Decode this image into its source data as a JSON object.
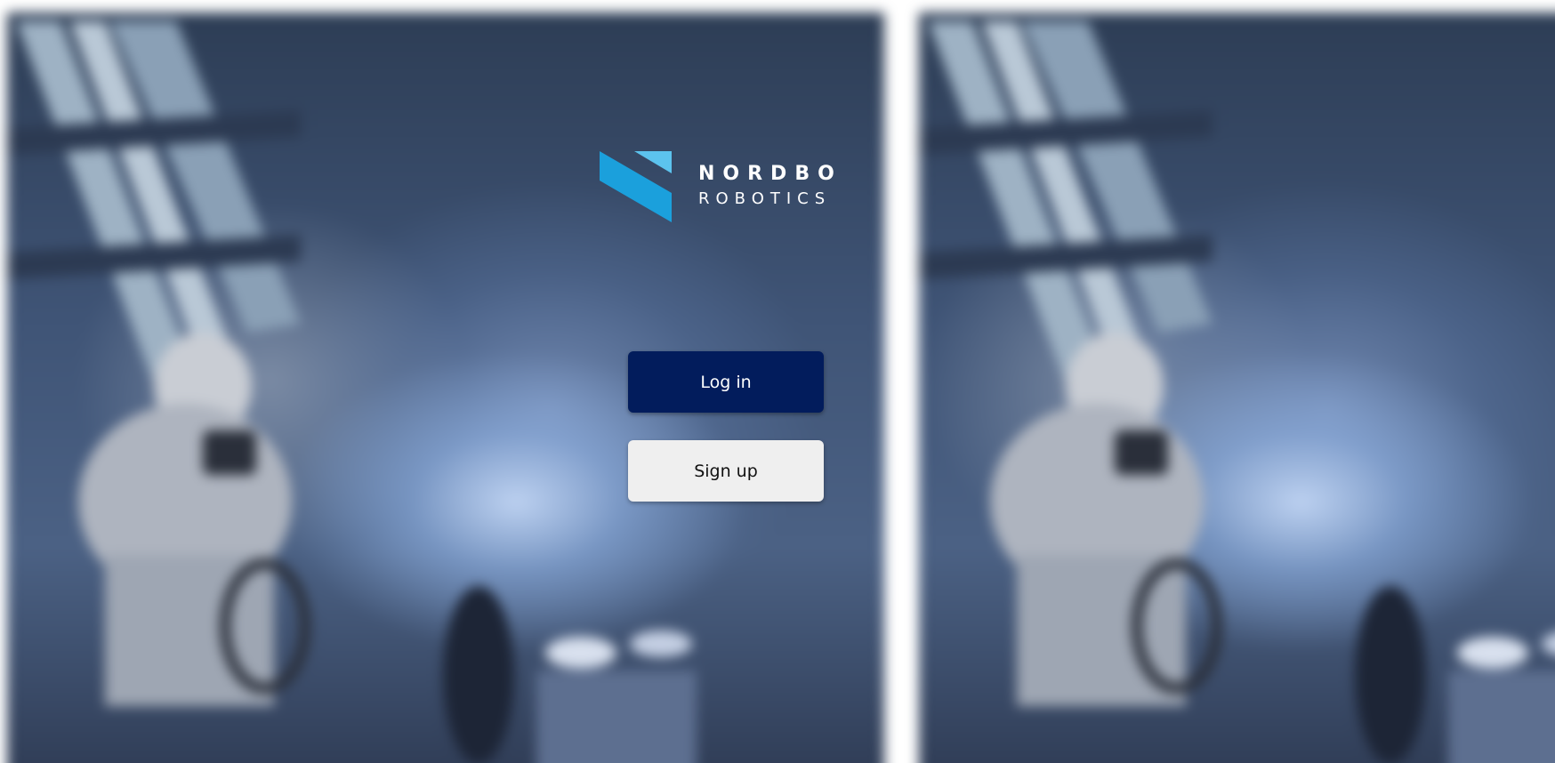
{
  "brand": {
    "name_line1": "NORDBO",
    "name_line2": "ROBOTICS",
    "logo_icon": "nordbo-logo-mark-icon",
    "colors": {
      "mark_primary": "#1ba0dc",
      "mark_light": "#5cc3ee",
      "text": "#ffffff"
    }
  },
  "auth": {
    "login_label": "Log in",
    "signup_label": "Sign up",
    "login_color": "#021c5c",
    "signup_color": "#efefef"
  },
  "background": {
    "description_icon": "blurred-spray-painting-photo"
  }
}
